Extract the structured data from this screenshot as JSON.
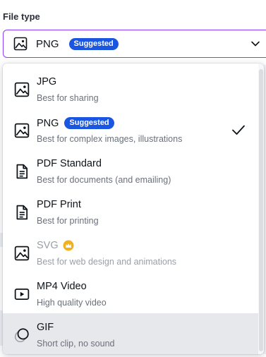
{
  "field_label": "File type",
  "select": {
    "value": "PNG",
    "badge": "Suggested"
  },
  "options": [
    {
      "title": "JPG",
      "desc": "Best for sharing",
      "icon": "image-icon"
    },
    {
      "title": "PNG",
      "desc": "Best for complex images, illustrations",
      "icon": "image-icon",
      "badge": "Suggested",
      "selected": true
    },
    {
      "title": "PDF Standard",
      "desc": "Best for documents (and emailing)",
      "icon": "document-icon"
    },
    {
      "title": "PDF Print",
      "desc": "Best for printing",
      "icon": "document-icon"
    },
    {
      "title": "SVG",
      "desc": "Best for web design and animations",
      "icon": "image-icon",
      "pro": true
    },
    {
      "title": "MP4 Video",
      "desc": "High quality video",
      "icon": "video-icon"
    },
    {
      "title": "GIF",
      "desc": "Short clip, no sound",
      "icon": "gif-icon",
      "hovered": true
    }
  ],
  "colors": {
    "accent": "#8b3dff",
    "badge": "#1a56e0",
    "crown": "#f2b01e",
    "hover": "#e6e8ec"
  }
}
